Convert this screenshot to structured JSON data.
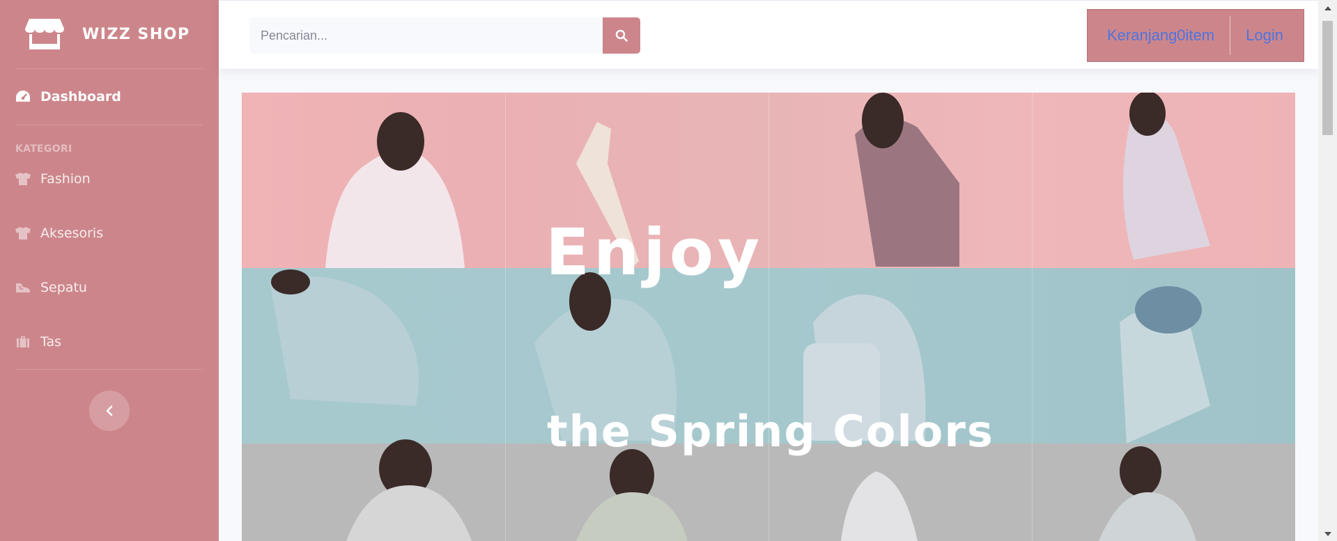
{
  "brand": {
    "name": "WIZZ SHOP",
    "icon": "store-icon"
  },
  "sidebar": {
    "dashboard": {
      "label": "Dashboard",
      "icon": "tachometer-icon"
    },
    "heading": "KATEGORI",
    "items": [
      {
        "label": "Fashion",
        "icon": "tshirt-icon"
      },
      {
        "label": "Aksesoris",
        "icon": "tshirt-icon"
      },
      {
        "label": "Sepatu",
        "icon": "shoe-icon"
      },
      {
        "label": "Tas",
        "icon": "briefcase-icon"
      }
    ],
    "toggle_icon": "chevron-left-icon"
  },
  "topbar": {
    "search_placeholder": "Pencarian...",
    "search_icon": "search-icon",
    "cart_label": "Keranjang0item",
    "login_label": "Login"
  },
  "banner": {
    "line1": "Enjoy",
    "line2": "the Spring Colors"
  },
  "colors": {
    "sidebar": "#cc868b",
    "link": "#4e73df",
    "page_bg": "#f8f9fc"
  }
}
